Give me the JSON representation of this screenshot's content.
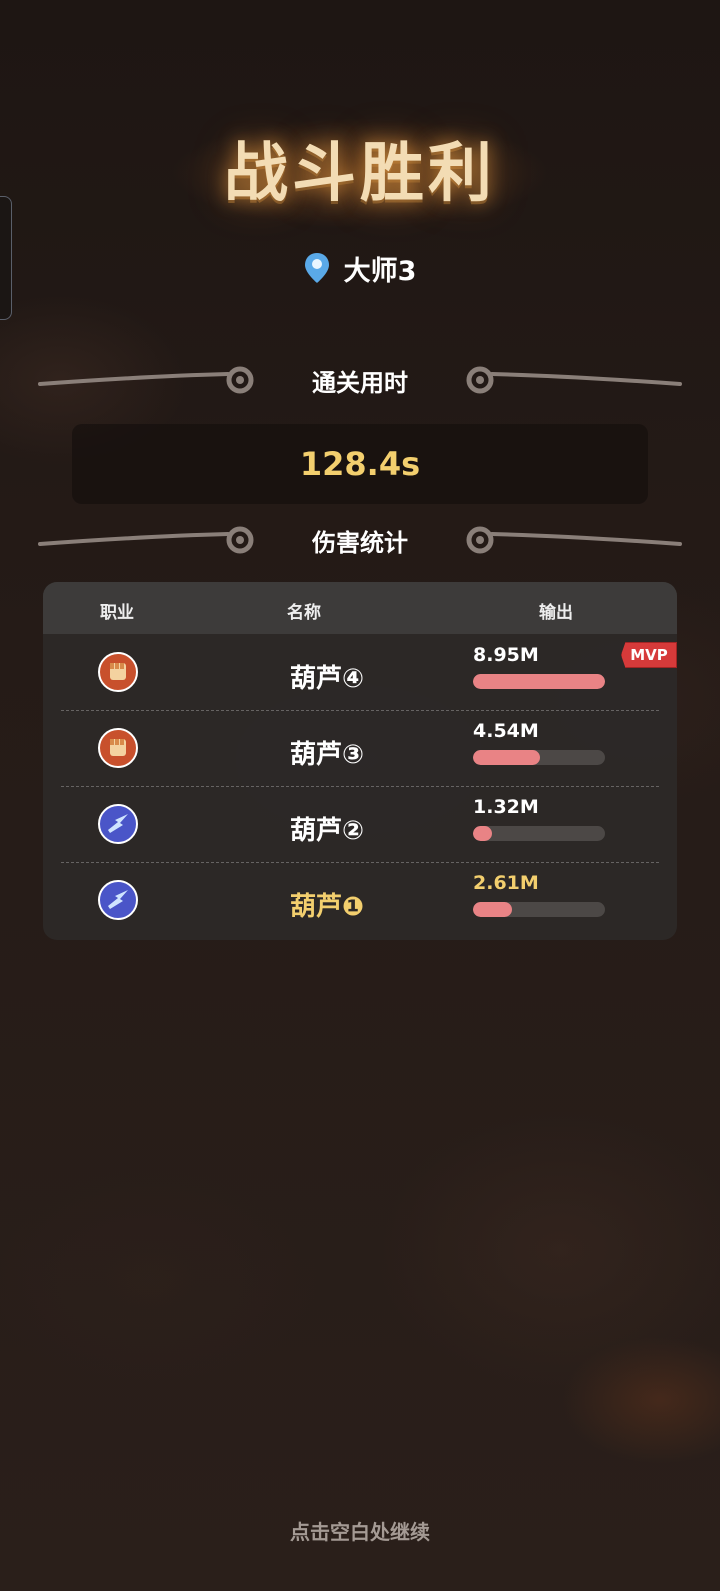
{
  "title": "战斗胜利",
  "location": {
    "label": "大师3",
    "icon": "location-pin-icon"
  },
  "clear_time": {
    "heading": "通关用时",
    "value": "128.4s"
  },
  "damage": {
    "heading": "伤害统计",
    "columns": {
      "class": "职业",
      "name": "名称",
      "output": "输出"
    },
    "rows": [
      {
        "class_icon": "fist-icon",
        "name": "葫芦④",
        "output": "8.95M",
        "fraction": 1.0,
        "mvp": "MVP",
        "is_self": false
      },
      {
        "class_icon": "fist-icon",
        "name": "葫芦③",
        "output": "4.54M",
        "fraction": 0.507,
        "mvp": "",
        "is_self": false
      },
      {
        "class_icon": "lightning-icon",
        "name": "葫芦②",
        "output": "1.32M",
        "fraction": 0.147,
        "mvp": "",
        "is_self": false
      },
      {
        "class_icon": "lightning-icon",
        "name": "葫芦❶",
        "output": "2.61M",
        "fraction": 0.292,
        "mvp": "",
        "is_self": true
      }
    ]
  },
  "footer": "点击空白处继续",
  "colors": {
    "accent_gold": "#f3cf6e",
    "bar_fill": "#e98385",
    "mvp_red": "#d63a3a",
    "title": "#f3dcb4"
  }
}
